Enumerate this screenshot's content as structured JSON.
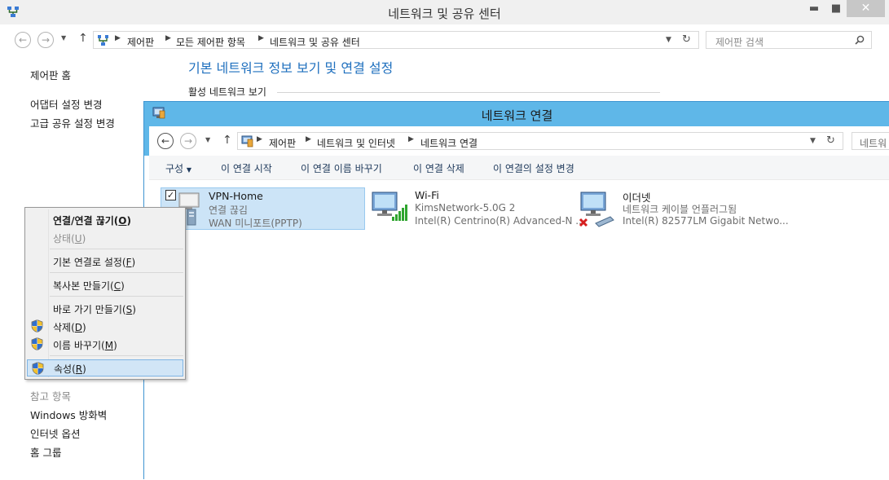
{
  "background_window": {
    "title": "네트워크 및 공유 센터",
    "window_controls": {
      "minimize": "▬",
      "maximize": "■",
      "close": "✕"
    },
    "breadcrumbs": [
      "제어판",
      "모든 제어판 항목",
      "네트워크 및 공유 센터"
    ],
    "search_placeholder": "제어판 검색",
    "left_nav": {
      "home": "제어판 홈",
      "adapter_settings": "어댑터 설정 변경",
      "advanced_sharing": "고급 공유 설정 변경"
    },
    "see_also": {
      "heading": "참고 항목",
      "links": [
        "Windows 방화벽",
        "인터넷 옵션",
        "홈 그룹"
      ]
    },
    "main_heading": "기본 네트워크 정보 보기 및 연결 설정",
    "section_label": "활성 네트워크 보기"
  },
  "foreground_window": {
    "title": "네트워크 연결",
    "breadcrumbs": [
      "제어판",
      "네트워크 및 인터넷",
      "네트워크 연결"
    ],
    "search_placeholder": "네트워",
    "toolbar": {
      "organize": "구성",
      "start": "이 연결 시작",
      "rename": "이 연결 이름 바꾸기",
      "delete": "이 연결 삭제",
      "settings": "이 연결의 설정 변경"
    },
    "connections": [
      {
        "name": "VPN-Home",
        "status": "연결 끊김",
        "device": "WAN 미니포트(PPTP)"
      },
      {
        "name": "Wi-Fi",
        "status": "KimsNetwork-5.0G  2",
        "device": "Intel(R) Centrino(R) Advanced-N ..."
      },
      {
        "name": "이더넷",
        "status": "네트워크 케이블 언플러그됨",
        "device": "Intel(R) 82577LM Gigabit Netwo..."
      }
    ]
  },
  "context_menu": {
    "items": [
      {
        "label": "연결/연결 끊기(O)",
        "text": "연결/연결 끊기(",
        "key": "O",
        "end": ")"
      },
      {
        "label": "상태(U)",
        "text": "상태(",
        "key": "U",
        "end": ")"
      },
      {
        "label": "기본 연결로 설정(F)",
        "text": "기본 연결로 설정(",
        "key": "F",
        "end": ")"
      },
      {
        "label": "복사본 만들기(C)",
        "text": "복사본 만들기(",
        "key": "C",
        "end": ")"
      },
      {
        "label": "바로 가기 만들기(S)",
        "text": "바로 가기 만들기(",
        "key": "S",
        "end": ")"
      },
      {
        "label": "삭제(D)",
        "text": "삭제(",
        "key": "D",
        "end": ")"
      },
      {
        "label": "이름 바꾸기(M)",
        "text": "이름 바꾸기(",
        "key": "M",
        "end": ")"
      },
      {
        "label": "속성(R)",
        "text": "속성(",
        "key": "R",
        "end": ")"
      }
    ]
  },
  "colors": {
    "title_active": "#5fb7e8",
    "selection_bg": "#cce4f7",
    "link_blue": "#1e6fbe",
    "close_inactive": "#c7c7c7"
  }
}
